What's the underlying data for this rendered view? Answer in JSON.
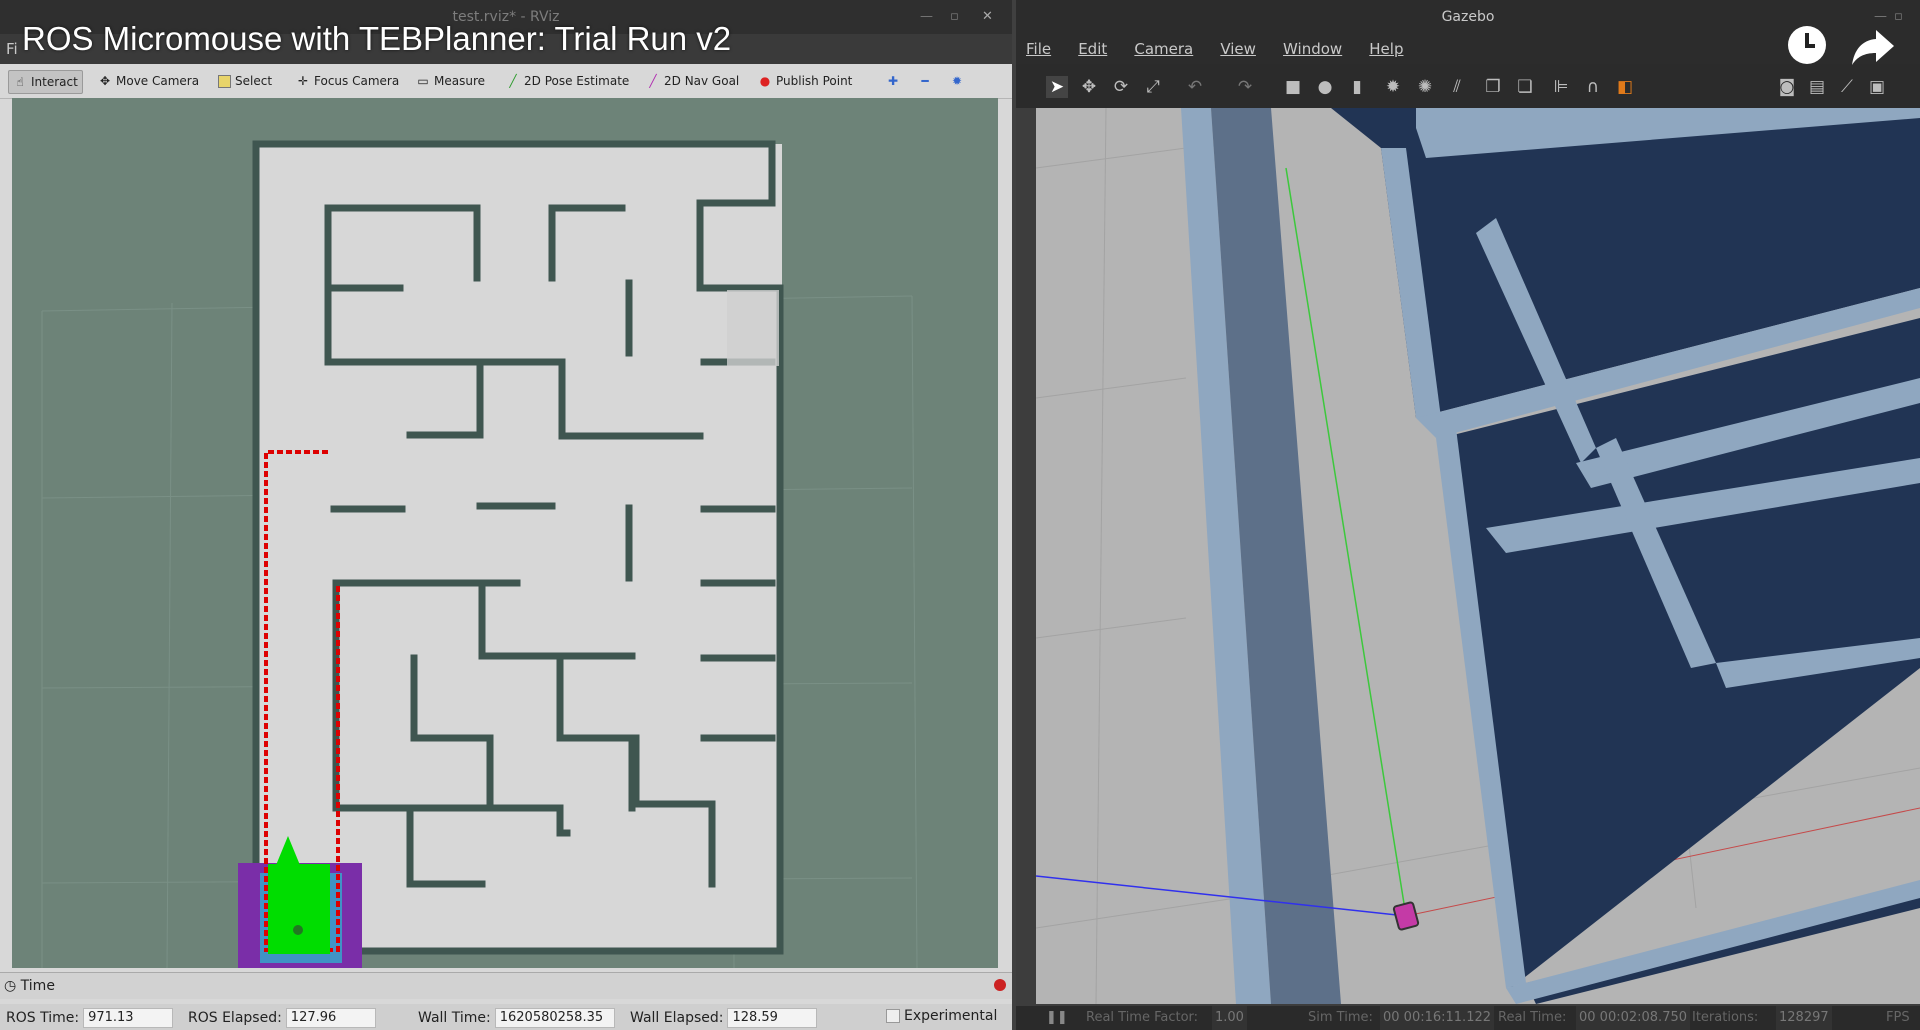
{
  "video": {
    "title": "ROS Micromouse with TEBPlanner: Trial Run v2"
  },
  "rviz": {
    "window_title": "test.rviz* - RViz",
    "menu_first": "Fi",
    "tools": [
      {
        "label": "Interact",
        "icon": "interact-icon"
      },
      {
        "label": "Move Camera",
        "icon": "move-camera-icon"
      },
      {
        "label": "Select",
        "icon": "select-icon"
      },
      {
        "label": "Focus Camera",
        "icon": "focus-camera-icon"
      },
      {
        "label": "Measure",
        "icon": "measure-icon"
      },
      {
        "label": "2D Pose Estimate",
        "icon": "pose-estimate-icon"
      },
      {
        "label": "2D Nav Goal",
        "icon": "nav-goal-icon"
      },
      {
        "label": "Publish Point",
        "icon": "publish-point-icon"
      }
    ],
    "time_panel": {
      "title": "Time"
    },
    "status": {
      "ros_time_label": "ROS Time:",
      "ros_time": "971.13",
      "ros_elapsed_label": "ROS Elapsed:",
      "ros_elapsed": "127.96",
      "wall_time_label": "Wall Time:",
      "wall_time": "1620580258.35",
      "wall_elapsed_label": "Wall Elapsed:",
      "wall_elapsed": "128.59",
      "experimental_label": "Experimental"
    }
  },
  "gazebo": {
    "window_title": "Gazebo",
    "menu": [
      "File",
      "Edit",
      "Camera",
      "View",
      "Window",
      "Help"
    ],
    "status": {
      "rtf_label": "Real Time Factor:",
      "rtf": "1.00",
      "sim_time_label": "Sim Time:",
      "sim_time": "00 00:16:11.122",
      "real_time_label": "Real Time:",
      "real_time": "00 00:02:08.750",
      "iterations_label": "Iterations:",
      "iterations": "128297",
      "fps_label": "FPS"
    }
  },
  "colors": {
    "rviz_bg": "#6d8378",
    "map_free": "#d7d7d7",
    "map_wall": "#3f5650",
    "path": "#dd0000",
    "robot": "#00dd00",
    "costmap": "#7a2ea8",
    "gazebo_wall": "#1f3251",
    "gazebo_floor": "#b4b4b4"
  }
}
